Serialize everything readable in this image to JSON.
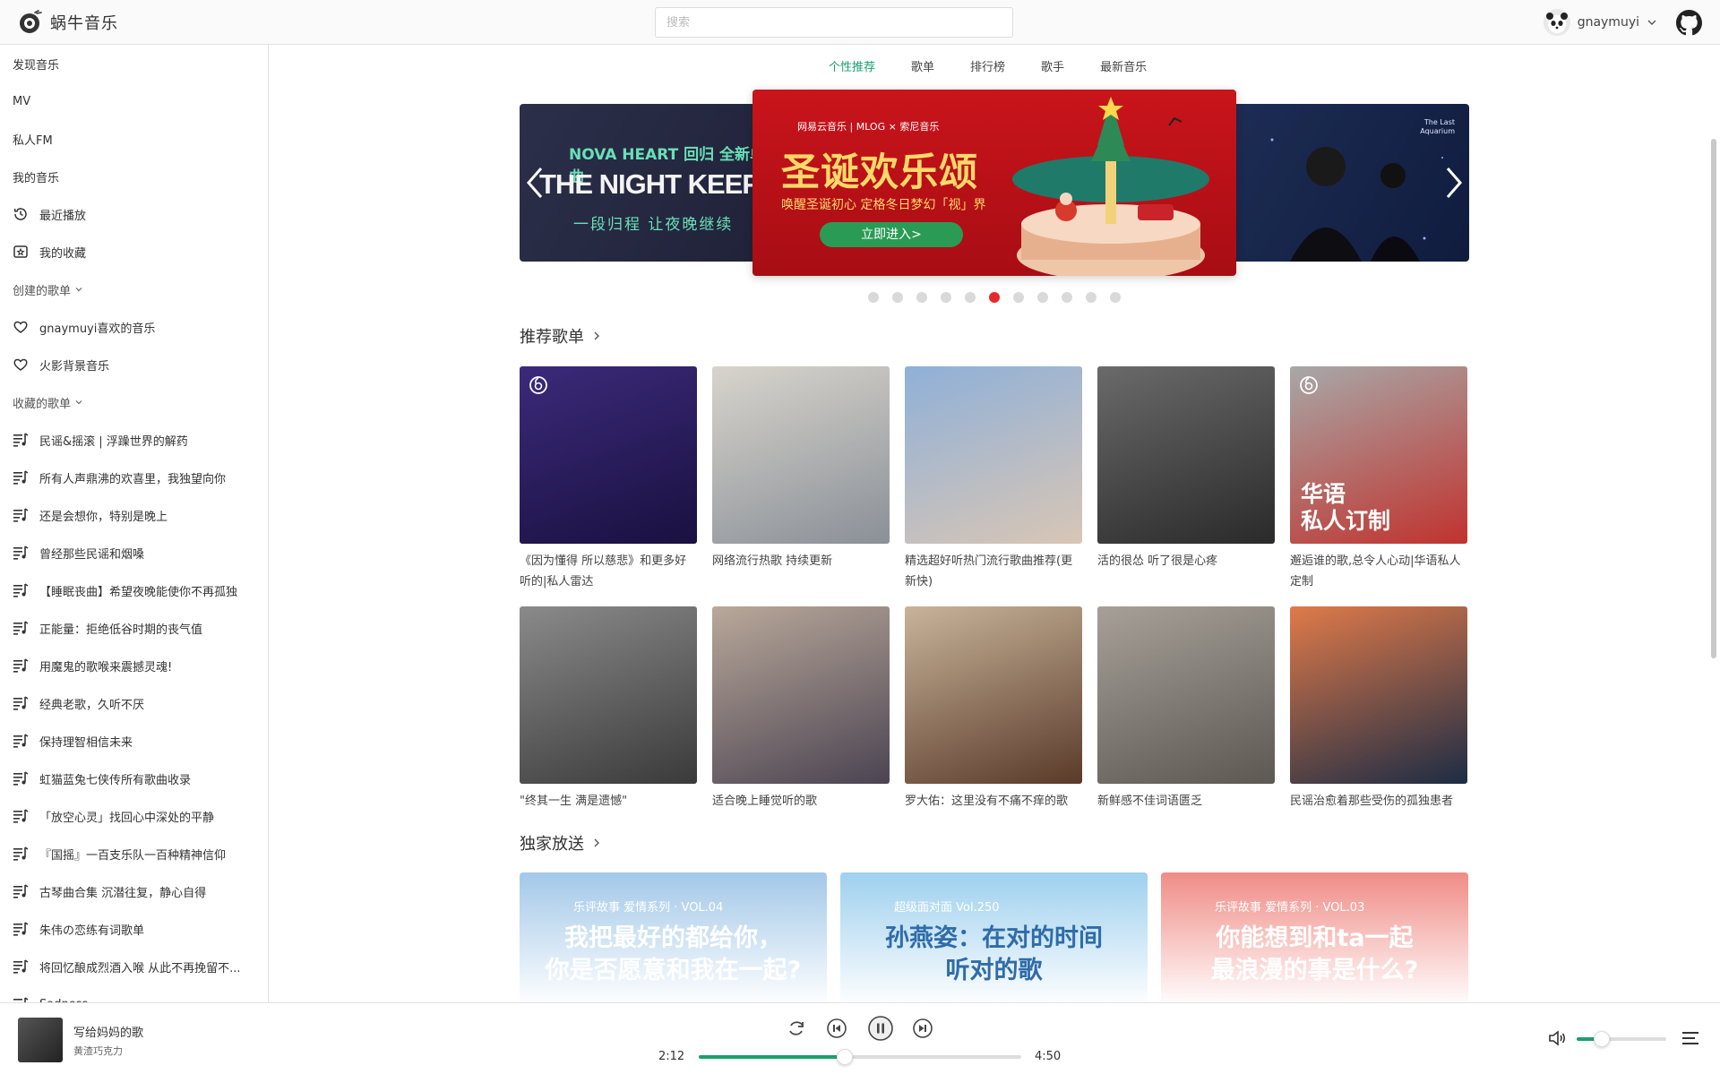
{
  "app": {
    "title": "蜗牛音乐"
  },
  "search": {
    "placeholder": "搜索"
  },
  "user": {
    "name": "gnaymuyi"
  },
  "sidebar": {
    "nav": [
      "发现音乐",
      "MV",
      "私人FM",
      "我的音乐"
    ],
    "my_music": [
      {
        "label": "最近播放",
        "icon": "clock-icon"
      },
      {
        "label": "我的收藏",
        "icon": "star-box-icon"
      }
    ],
    "created_header": "创建的歌单",
    "created": [
      "gnaymuyi喜欢的音乐",
      "火影背景音乐"
    ],
    "collected_header": "收藏的歌单",
    "collected": [
      "民谣&摇滚 | 浮躁世界的解药",
      "所有人声鼎沸的欢喜里，我独望向你",
      "还是会想你，特别是晚上",
      "曾经那些民谣和烟嗓",
      "【睡眠丧曲】希望夜晚能使你不再孤独",
      "正能量：拒绝低谷时期的丧气值",
      "用魔鬼的歌喉来震撼灵魂!",
      "经典老歌，久听不厌",
      "保持理智相信未来",
      "虹猫蓝兔七侠传所有歌曲收录",
      "「放空心灵」找回心中深处的平静",
      "『国摇』一百支乐队一百种精神信仰",
      "古琴曲合集 沉潜往复，静心自得",
      "朱伟の恋练有词歌单",
      "将回忆酿成烈酒入喉 从此不再挽留不...",
      "Sadness"
    ]
  },
  "tabs": [
    "个性推荐",
    "歌单",
    "排行榜",
    "歌手",
    "最新音乐"
  ],
  "active_tab": 0,
  "carousel": {
    "left": {
      "small": "NOVA HEART 回归 全新单曲",
      "big": "THE NIGHT KEEPS GOIN",
      "sub": "一段归程 让夜晚继续"
    },
    "center": {
      "brand": "网易云音乐 | MLOG × 索尼音乐",
      "title": "圣诞欢乐颂",
      "sub": "唤醒圣诞初心 定格冬日梦幻「视」界",
      "button": "立即进入>"
    },
    "right": {
      "caption": "The Last Aquarium"
    },
    "dot_count": 11,
    "active_dot": 5
  },
  "recommended": {
    "title": "推荐歌单",
    "row1": [
      {
        "caption": "《因为懂得 所以慈悲》和更多好听的|私人雷达",
        "colors": [
          "#3b2a7a",
          "#1a1040"
        ],
        "badge": true,
        "overlay": ""
      },
      {
        "caption": "网络流行热歌 持续更新",
        "colors": [
          "#d8d4cc",
          "#8a9098"
        ],
        "badge": false,
        "overlay": ""
      },
      {
        "caption": "精选超好听热门流行歌曲推荐(更新快)",
        "colors": [
          "#8fb0d8",
          "#d8c6b5"
        ],
        "badge": false,
        "overlay": ""
      },
      {
        "caption": "活的很怂 听了很是心疼",
        "colors": [
          "#6a6a6a",
          "#2a2a2a"
        ],
        "badge": false,
        "overlay": ""
      },
      {
        "caption": "邂逅谁的歌,总令人心动|华语私人定制",
        "colors": [
          "#a8a8a8",
          "#c0332e"
        ],
        "badge": true,
        "overlay": "华语\n私人订制"
      }
    ],
    "row2": [
      {
        "caption": "\"终其一生 满是遗憾\"",
        "colors": [
          "#8a8a8a",
          "#3a3a3a"
        ]
      },
      {
        "caption": "适合晚上睡觉听的歌",
        "colors": [
          "#b9a89a",
          "#4b4452"
        ]
      },
      {
        "caption": "罗大佑：这里没有不痛不痒的歌",
        "colors": [
          "#c8b49a",
          "#5a3a2a"
        ]
      },
      {
        "caption": "新鲜感不佳词语匮乏",
        "colors": [
          "#a6a098",
          "#5c5852"
        ]
      },
      {
        "caption": "民谣治愈着那些受伤的孤独患者",
        "colors": [
          "#e07a4a",
          "#1d2c44"
        ]
      }
    ]
  },
  "exclusive": {
    "title": "独家放送",
    "items": [
      {
        "label": "乐评故事 爱情系列 · VOL.04",
        "text": "我把最好的都给你，\n你是否愿意和我在一起?",
        "bg": "#a3c8e8",
        "fg": "#ffffff"
      },
      {
        "label": "超级面对面 Vol.250",
        "text": "孙燕姿：在对的时间\n听对的歌",
        "bg": "#9ed0ee",
        "fg": "#2f6ca8"
      },
      {
        "label": "乐评故事 爱情系列 · VOL.03",
        "text": "你能想到和ta一起\n最浪漫的事是什么?",
        "bg": "#f08c86",
        "fg": "#ffffff"
      }
    ]
  },
  "player": {
    "song": "写给妈妈的歌",
    "artist": "黄渣巧克力",
    "current": "2:12",
    "duration": "4:50",
    "progress": 0.453,
    "volume": 0.28
  },
  "colors": {
    "accent": "#1aa06d",
    "dot_active": "#e42b2b"
  }
}
